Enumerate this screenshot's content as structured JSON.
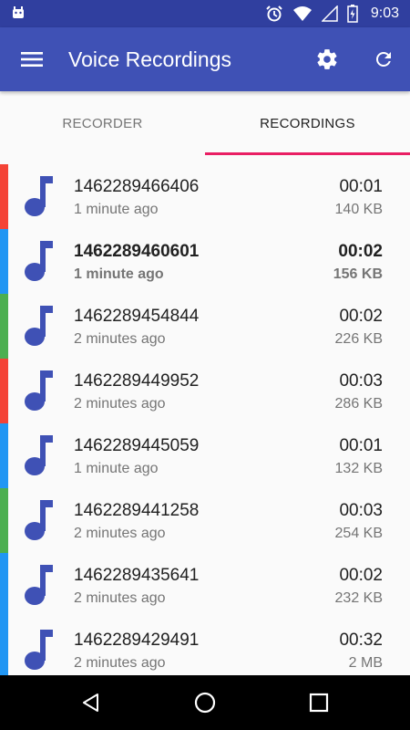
{
  "status_bar": {
    "time": "9:03",
    "left_icon": "android-debug-icon",
    "icons": [
      "alarm-icon",
      "wifi-icon",
      "signal-icon",
      "battery-icon"
    ]
  },
  "app_bar": {
    "title": "Voice Recordings",
    "icons": [
      "menu-icon",
      "settings-icon",
      "refresh-icon"
    ],
    "color": "#3f51b5"
  },
  "tabs": [
    {
      "label": "RECORDER",
      "active": false
    },
    {
      "label": "RECORDINGS",
      "active": true
    }
  ],
  "colors": {
    "primary_dark": "#303f9f",
    "primary": "#3f51b5",
    "accent": "#e91e63",
    "stripe_red": "#f44336",
    "stripe_blue": "#2196f3",
    "stripe_green": "#4caf50"
  },
  "recordings": [
    {
      "name": "1462289466406",
      "age": "1 minute ago",
      "duration": "00:01",
      "size": "140 KB",
      "stripe": "#f44336",
      "bold": false
    },
    {
      "name": "1462289460601",
      "age": "1 minute ago",
      "duration": "00:02",
      "size": "156 KB",
      "stripe": "#2196f3",
      "bold": true
    },
    {
      "name": "1462289454844",
      "age": "2 minutes ago",
      "duration": "00:02",
      "size": "226 KB",
      "stripe": "#4caf50",
      "bold": false
    },
    {
      "name": "1462289449952",
      "age": "2 minutes ago",
      "duration": "00:03",
      "size": "286 KB",
      "stripe": "#f44336",
      "bold": false
    },
    {
      "name": "1462289445059",
      "age": "1 minute ago",
      "duration": "00:01",
      "size": "132 KB",
      "stripe": "#2196f3",
      "bold": false
    },
    {
      "name": "1462289441258",
      "age": "2 minutes ago",
      "duration": "00:03",
      "size": "254 KB",
      "stripe": "#4caf50",
      "bold": false
    },
    {
      "name": "1462289435641",
      "age": "2 minutes ago",
      "duration": "00:02",
      "size": "232 KB",
      "stripe": "#2196f3",
      "bold": false
    },
    {
      "name": "1462289429491",
      "age": "2 minutes ago",
      "duration": "00:32",
      "size": "2 MB",
      "stripe": "#2196f3",
      "bold": false
    }
  ],
  "nav_bar": {
    "icons": [
      "back-icon",
      "home-icon",
      "recents-icon"
    ]
  }
}
